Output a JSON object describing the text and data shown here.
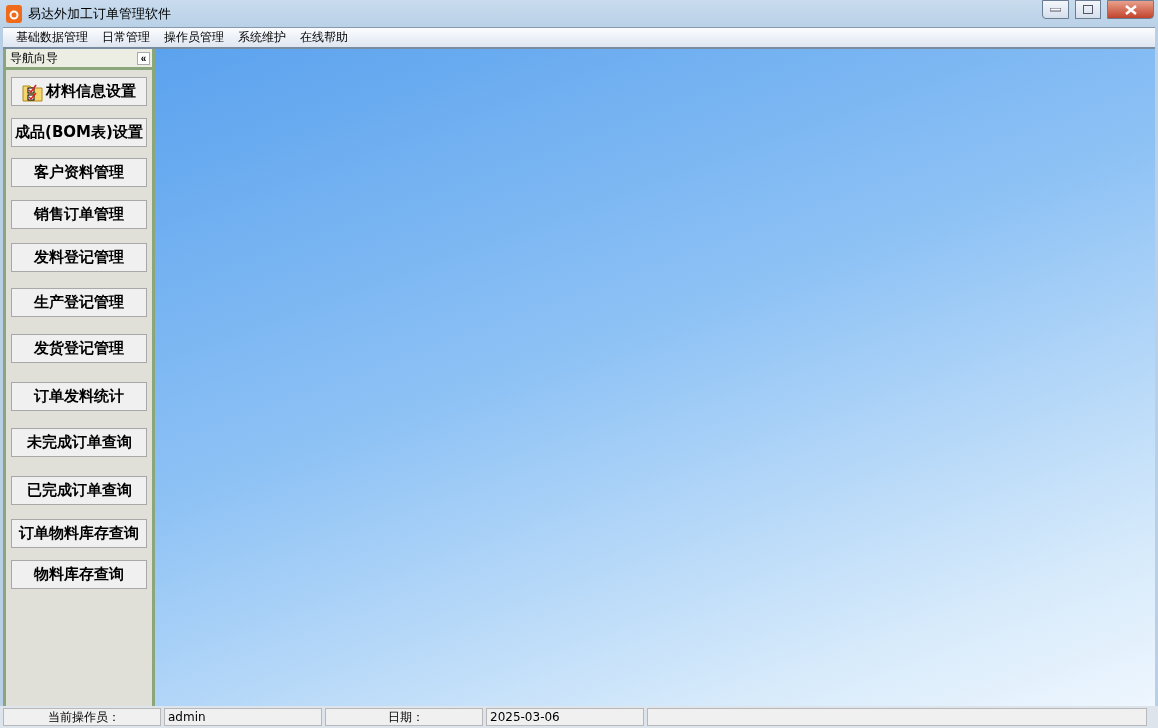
{
  "window": {
    "title": "易达外加工订单管理软件"
  },
  "menu": [
    "基础数据管理",
    "日常管理",
    "操作员管理",
    "系统维护",
    "在线帮助"
  ],
  "sidebar": {
    "title": "导航向导",
    "collapse": "«",
    "items": [
      {
        "label": "材料信息设置",
        "kind": "icon"
      },
      {
        "label": "成品(BOM表)设置",
        "kind": "plain"
      },
      {
        "label": "客户资料管理",
        "kind": "plain"
      },
      {
        "label": "销售订单管理",
        "kind": "plain"
      },
      {
        "label": "发料登记管理",
        "kind": "plain"
      },
      {
        "label": "生产登记管理",
        "kind": "plain"
      },
      {
        "label": "发货登记管理",
        "kind": "plain"
      },
      {
        "label": "订单发料统计",
        "kind": "plain"
      },
      {
        "label": "未完成订单查询",
        "kind": "plain"
      },
      {
        "label": "已完成订单查询",
        "kind": "plain"
      },
      {
        "label": "订单物料库存查询",
        "kind": "plain"
      },
      {
        "label": "物料库存查询",
        "kind": "plain"
      }
    ]
  },
  "status_bar": [
    {
      "text": "当前操作员：",
      "kind": "label"
    },
    {
      "text": "admin",
      "kind": "value"
    },
    {
      "text": "日期：",
      "kind": "label"
    },
    {
      "text": "2025-03-06",
      "kind": "value"
    }
  ]
}
